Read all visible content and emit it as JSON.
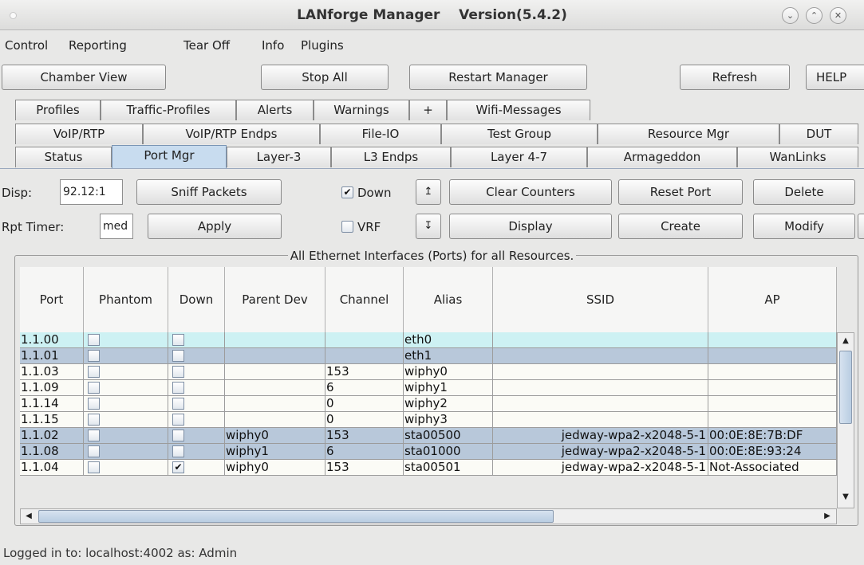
{
  "window": {
    "title": "LANforge Manager    Version(5.4.2)"
  },
  "menu": {
    "control": "Control",
    "reporting": "Reporting",
    "tear_off": "Tear Off",
    "info": "Info",
    "plugins": "Plugins"
  },
  "toolbar": {
    "chamber_view": "Chamber View",
    "stop_all": "Stop All",
    "restart_manager": "Restart Manager",
    "refresh": "Refresh",
    "help": "HELP"
  },
  "tabs": {
    "row1": [
      "Profiles",
      "Traffic-Profiles",
      "Alerts",
      "Warnings",
      "+",
      "Wifi-Messages"
    ],
    "row2": [
      "VoIP/RTP",
      "VoIP/RTP Endps",
      "File-IO",
      "Test Group",
      "Resource Mgr",
      "DUT"
    ],
    "row3": [
      "Status",
      "Port Mgr",
      "Layer-3",
      "L3 Endps",
      "Layer 4-7",
      "Armageddon",
      "WanLinks"
    ],
    "selected": "Port Mgr"
  },
  "controls": {
    "disp_label": "Disp:",
    "disp_value": "92.12:1",
    "sniff_packets": "Sniff Packets",
    "down_label": "Down",
    "down_checked": true,
    "clear_counters": "Clear Counters",
    "reset_port": "Reset Port",
    "delete": "Delete",
    "rpt_timer_label": "Rpt Timer:",
    "rpt_timer_value": "med",
    "apply": "Apply",
    "vrf_label": "VRF",
    "vrf_checked": false,
    "display": "Display",
    "create": "Create",
    "modify": "Modify"
  },
  "table": {
    "title": "All Ethernet Interfaces (Ports) for all Resources.",
    "columns": [
      "Port",
      "Phantom",
      "Down",
      "Parent Dev",
      "Channel",
      "Alias",
      "SSID",
      "AP"
    ],
    "rows": [
      {
        "port": "1.1.00",
        "phantom": false,
        "down": false,
        "parent": "",
        "channel": "",
        "alias": "eth0",
        "ssid": "",
        "ap": "",
        "bg": "#cdf1f3"
      },
      {
        "port": "1.1.01",
        "phantom": false,
        "down": false,
        "parent": "",
        "channel": "",
        "alias": "eth1",
        "ssid": "",
        "ap": "",
        "bg": "#b8c8da"
      },
      {
        "port": "1.1.03",
        "phantom": false,
        "down": false,
        "parent": "",
        "channel": "153",
        "alias": "wiphy0",
        "ssid": "",
        "ap": "",
        "bg": "#fbfbf6"
      },
      {
        "port": "1.1.09",
        "phantom": false,
        "down": false,
        "parent": "",
        "channel": "6",
        "alias": "wiphy1",
        "ssid": "",
        "ap": "",
        "bg": "#fbfbf6"
      },
      {
        "port": "1.1.14",
        "phantom": false,
        "down": false,
        "parent": "",
        "channel": "0",
        "alias": "wiphy2",
        "ssid": "",
        "ap": "",
        "bg": "#fbfbf6"
      },
      {
        "port": "1.1.15",
        "phantom": false,
        "down": false,
        "parent": "",
        "channel": "0",
        "alias": "wiphy3",
        "ssid": "",
        "ap": "",
        "bg": "#fbfbf6"
      },
      {
        "port": "1.1.02",
        "phantom": false,
        "down": false,
        "parent": "wiphy0",
        "channel": "153",
        "alias": "sta00500",
        "ssid": "jedway-wpa2-x2048-5-1",
        "ap": "00:0E:8E:7B:DF",
        "bg": "#b8c8da"
      },
      {
        "port": "1.1.08",
        "phantom": false,
        "down": false,
        "parent": "wiphy1",
        "channel": "6",
        "alias": "sta01000",
        "ssid": "jedway-wpa2-x2048-5-1",
        "ap": "00:0E:8E:93:24",
        "bg": "#b8c8da"
      },
      {
        "port": "1.1.04",
        "phantom": false,
        "down": true,
        "parent": "wiphy0",
        "channel": "153",
        "alias": "sta00501",
        "ssid": "jedway-wpa2-x2048-5-1",
        "ap": "Not-Associated",
        "bg": "#fbfbf6"
      }
    ]
  },
  "status": {
    "text": "Logged in to:  localhost:4002  as:  Admin"
  }
}
